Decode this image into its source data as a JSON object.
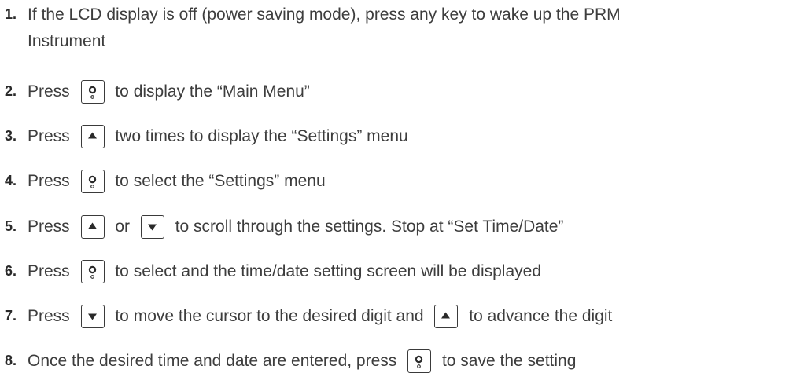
{
  "steps": [
    {
      "num": "1.",
      "line1": "If the LCD display is off (power saving mode), press any key to wake up the PRM",
      "line2": "Instrument"
    },
    {
      "num": "2.",
      "parts": [
        {
          "text": "Press "
        },
        {
          "icon": "select-icon"
        },
        {
          "text": " to display the “Main Menu”"
        }
      ]
    },
    {
      "num": "3.",
      "parts": [
        {
          "text": "Press "
        },
        {
          "icon": "up-arrow-icon"
        },
        {
          "text": " two times to display the “Settings” menu"
        }
      ]
    },
    {
      "num": "4.",
      "parts": [
        {
          "text": "Press "
        },
        {
          "icon": "select-icon"
        },
        {
          "text": " to select the “Settings” menu"
        }
      ]
    },
    {
      "num": "5.",
      "parts": [
        {
          "text": "Press "
        },
        {
          "icon": "up-arrow-icon"
        },
        {
          "text": " or "
        },
        {
          "icon": "down-arrow-icon"
        },
        {
          "text": " to scroll through the settings. Stop at “Set Time/Date”"
        }
      ]
    },
    {
      "num": "6.",
      "parts": [
        {
          "text": "Press "
        },
        {
          "icon": "select-icon"
        },
        {
          "text": " to select and the time/date setting screen will be displayed"
        }
      ]
    },
    {
      "num": "7.",
      "parts": [
        {
          "text": "Press "
        },
        {
          "icon": "down-arrow-icon"
        },
        {
          "text": " to move the cursor to the desired digit and "
        },
        {
          "icon": "up-arrow-icon"
        },
        {
          "text": " to advance the digit"
        }
      ]
    },
    {
      "num": "8.",
      "parts": [
        {
          "text": "Once the desired time and date are entered, press "
        },
        {
          "icon": "select-icon"
        },
        {
          "text": " to save the setting"
        }
      ]
    }
  ],
  "colors": {
    "text": "#3d3d3d",
    "number": "#2a2a2a",
    "key_border": "#3a3a3a"
  }
}
